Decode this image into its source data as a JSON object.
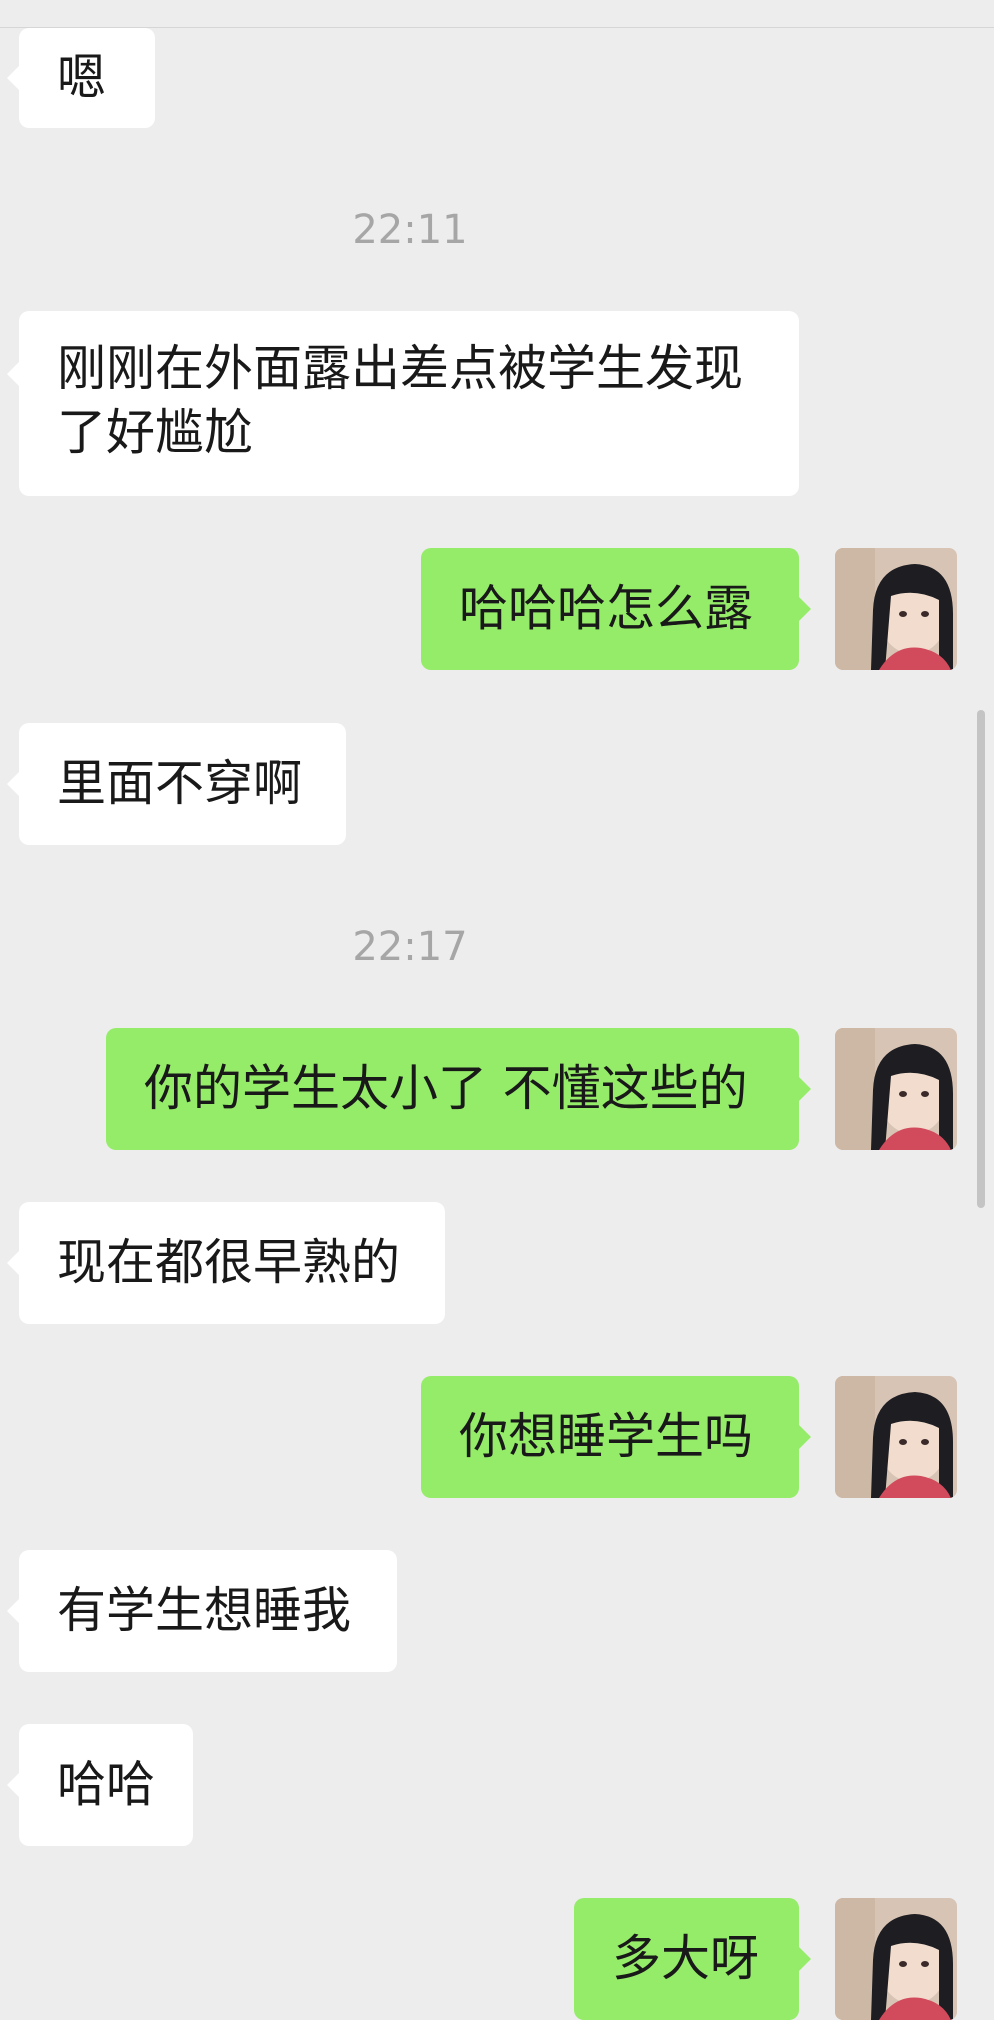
{
  "chat": {
    "timestamps": [
      "22:11",
      "22:17"
    ],
    "messages": [
      {
        "from": "contact",
        "text": "嗯"
      },
      {
        "from": "contact",
        "lines": [
          "刚刚在外面露出差点被学生发现",
          "了好尴尬"
        ]
      },
      {
        "from": "me",
        "text": "哈哈哈怎么露"
      },
      {
        "from": "contact",
        "text": "里面不穿啊"
      },
      {
        "from": "me",
        "text": "你的学生太小了 不懂这些的"
      },
      {
        "from": "contact",
        "text": "现在都很早熟的"
      },
      {
        "from": "me",
        "text": "你想睡学生吗"
      },
      {
        "from": "contact",
        "text": "有学生想睡我"
      },
      {
        "from": "contact",
        "text": "哈哈"
      },
      {
        "from": "me",
        "text": "多大呀"
      }
    ]
  },
  "colors": {
    "background": "#ededed",
    "incoming_bubble": "#ffffff",
    "outgoing_bubble": "#95ec69",
    "timestamp_text": "#a6a6a6"
  },
  "icons": [
    "user-avatar-icon"
  ]
}
